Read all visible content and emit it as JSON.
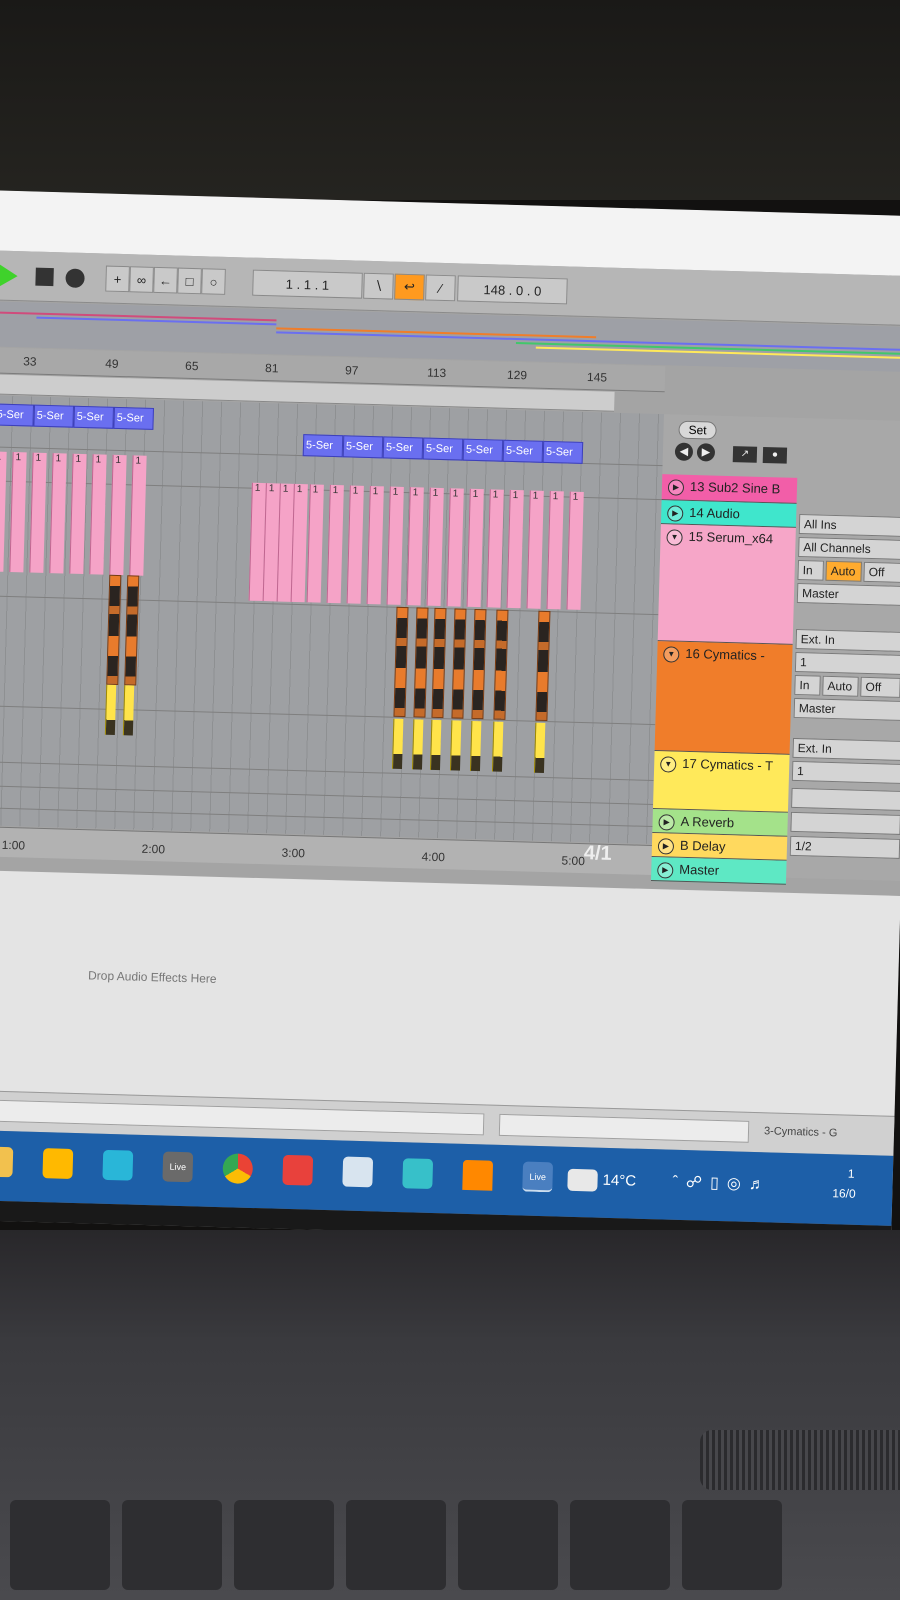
{
  "transport": {
    "position": "1 . 1 . 1",
    "tempo": "148 . 0 . 0"
  },
  "ruler": {
    "bars": [
      "33",
      "49",
      "65",
      "81",
      "97",
      "113",
      "129",
      "145"
    ]
  },
  "timeline": {
    "marks": [
      "1:00",
      "2:00",
      "3:00",
      "4:00",
      "5:00"
    ],
    "zoom": "4/1"
  },
  "clips": {
    "blue_label": "5-Ser",
    "pink_label": "1"
  },
  "header": {
    "set_label": "Set"
  },
  "tracks": [
    {
      "name": "13 Sub2 Sine B",
      "color": "#f25ea8"
    },
    {
      "name": "14 Audio",
      "color": "#3fe6cc"
    },
    {
      "name": "15 Serum_x64",
      "color": "#f6a6c8"
    },
    {
      "name": "16 Cymatics -",
      "color": "#f07d2a"
    },
    {
      "name": "17 Cymatics - T",
      "color": "#ffe95a"
    },
    {
      "name": "A Reverb",
      "color": "#a4e28a"
    },
    {
      "name": "B Delay",
      "color": "#ffd95e"
    },
    {
      "name": "Master",
      "color": "#5ee8c4"
    }
  ],
  "io": {
    "serum": {
      "input": "All Ins",
      "channel": "All Channels",
      "in": "In",
      "auto": "Auto",
      "off": "Off",
      "output": "Master"
    },
    "cym16": {
      "input": "Ext. In",
      "channel": "1",
      "in": "In",
      "auto": "Auto",
      "off": "Off",
      "output": "Master"
    },
    "cym17": {
      "input": "Ext. In",
      "channel": "1"
    },
    "master": {
      "output": "1/2"
    }
  },
  "devices": {
    "drop_hint": "Drop Audio Effects Here"
  },
  "status": {
    "text": "3-Cymatics - G"
  },
  "taskbar": {
    "live_label": "Live",
    "temperature": "14°C",
    "clock_time": "1",
    "clock_date": "16/0"
  }
}
